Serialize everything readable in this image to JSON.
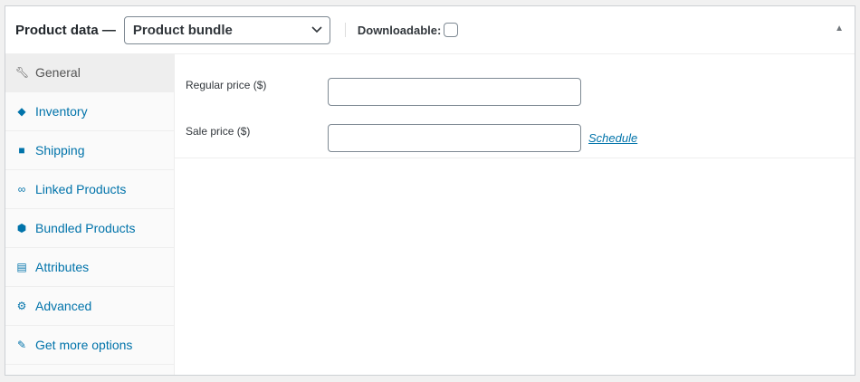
{
  "header": {
    "title": "Product data —",
    "product_type": "Product bundle",
    "downloadable_label": "Downloadable:",
    "downloadable_checked": false
  },
  "tabs": [
    {
      "label": "General",
      "icon": "wrench-icon",
      "active": true
    },
    {
      "label": "Inventory",
      "icon": "tag-icon"
    },
    {
      "label": "Shipping",
      "icon": "truck-icon"
    },
    {
      "label": "Linked Products",
      "icon": "link-icon"
    },
    {
      "label": "Bundled Products",
      "icon": "box-icon"
    },
    {
      "label": "Attributes",
      "icon": "list-card-icon"
    },
    {
      "label": "Advanced",
      "icon": "gear-icon"
    },
    {
      "label": "Get more options",
      "icon": "plugin-icon"
    }
  ],
  "fields": {
    "regular_price_label": "Regular price ($)",
    "regular_price_value": "",
    "sale_price_label": "Sale price ($)",
    "sale_price_value": "",
    "schedule_link": "Schedule"
  }
}
